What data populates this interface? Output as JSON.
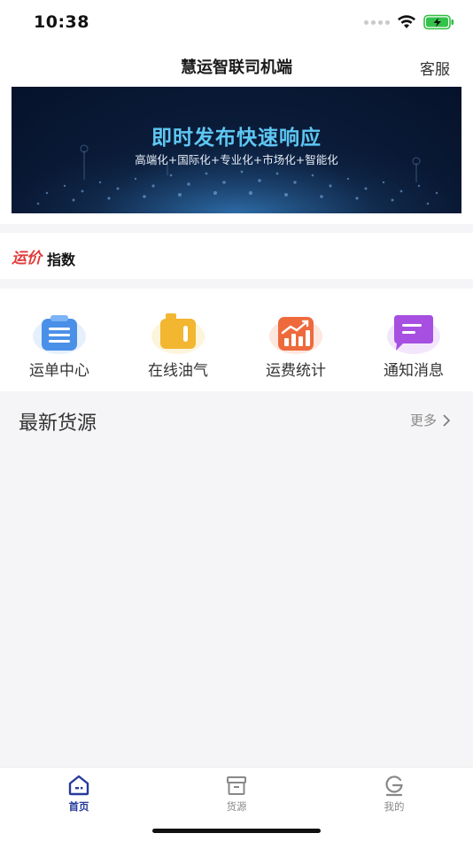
{
  "status": {
    "time": "10:38"
  },
  "nav": {
    "title": "慧运智联司机端",
    "right_label": "客服"
  },
  "banner": {
    "title": "即时发布快速响应",
    "subtitle": "高端化+国际化+专业化+市场化+智能化"
  },
  "index": {
    "logo_text": "运价",
    "label": "指数"
  },
  "quick_menu": [
    {
      "label": "运单中心",
      "icon": "clipboard-icon",
      "color": "#4a90e8"
    },
    {
      "label": "在线油气",
      "icon": "fuel-icon",
      "color": "#f2b630"
    },
    {
      "label": "运费统计",
      "icon": "chart-icon",
      "color": "#ee6a3c"
    },
    {
      "label": "通知消息",
      "icon": "message-icon",
      "color": "#a64fe0"
    }
  ],
  "latest": {
    "title": "最新货源",
    "more_label": "更多"
  },
  "tabs": [
    {
      "label": "首页",
      "icon": "home-icon",
      "active": true
    },
    {
      "label": "货源",
      "icon": "cargo-box-icon",
      "active": false
    },
    {
      "label": "我的",
      "icon": "profile-icon",
      "active": false
    }
  ],
  "colors": {
    "accent": "#253a9c",
    "inactive": "#888888",
    "background": "#f5f5f7"
  }
}
